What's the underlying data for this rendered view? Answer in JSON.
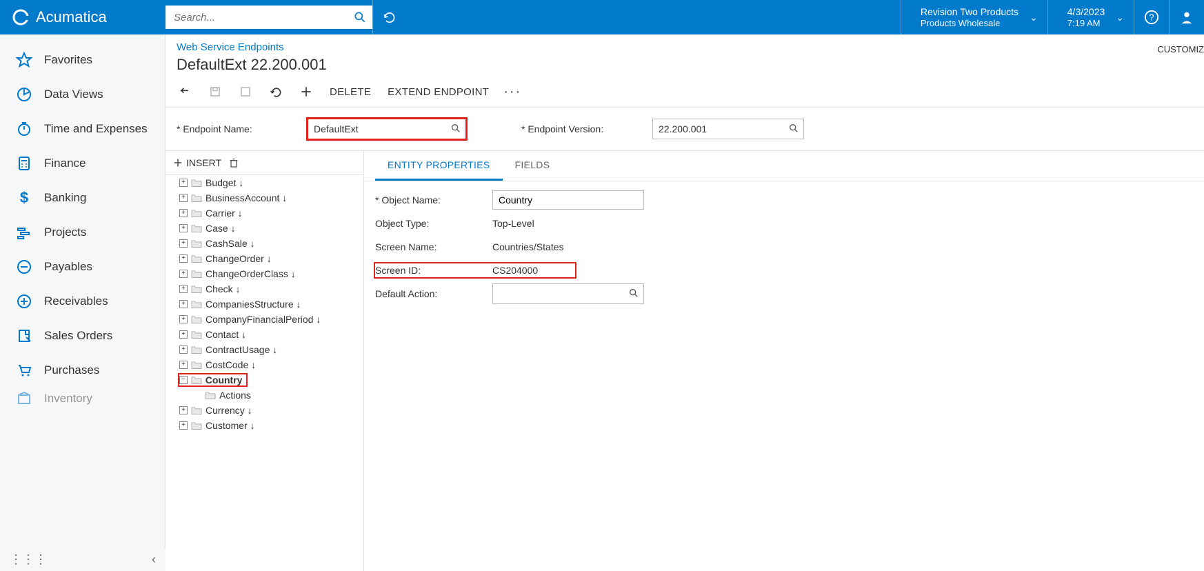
{
  "brand": "Acumatica",
  "search": {
    "placeholder": "Search..."
  },
  "header": {
    "company": "Revision Two Products",
    "company_sub": "Products Wholesale",
    "date": "4/3/2023",
    "time": "7:19 AM"
  },
  "sidebar": {
    "items": [
      {
        "label": "Favorites",
        "icon": "star"
      },
      {
        "label": "Data Views",
        "icon": "pie"
      },
      {
        "label": "Time and Expenses",
        "icon": "stopwatch"
      },
      {
        "label": "Finance",
        "icon": "calculator"
      },
      {
        "label": "Banking",
        "icon": "dollar"
      },
      {
        "label": "Projects",
        "icon": "gantt"
      },
      {
        "label": "Payables",
        "icon": "minus-circle"
      },
      {
        "label": "Receivables",
        "icon": "plus-circle"
      },
      {
        "label": "Sales Orders",
        "icon": "note"
      },
      {
        "label": "Purchases",
        "icon": "cart"
      },
      {
        "label": "Inventory",
        "icon": "box"
      }
    ]
  },
  "breadcrumb": "Web Service Endpoints",
  "page_title": "DefaultExt 22.200.001",
  "customize": "CUSTOMIZ",
  "toolbar": {
    "delete": "DELETE",
    "extend": "EXTEND ENDPOINT"
  },
  "form": {
    "endpoint_name_label": "Endpoint Name:",
    "endpoint_name_value": "DefaultExt",
    "endpoint_version_label": "Endpoint Version:",
    "endpoint_version_value": "22.200.001"
  },
  "tree_toolbar": {
    "insert": "INSERT"
  },
  "tree": {
    "nodes": [
      {
        "label": "Budget ↓"
      },
      {
        "label": "BusinessAccount ↓"
      },
      {
        "label": "Carrier ↓"
      },
      {
        "label": "Case ↓"
      },
      {
        "label": "CashSale ↓"
      },
      {
        "label": "ChangeOrder ↓"
      },
      {
        "label": "ChangeOrderClass ↓"
      },
      {
        "label": "Check ↓"
      },
      {
        "label": "CompaniesStructure ↓"
      },
      {
        "label": "CompanyFinancialPeriod ↓"
      },
      {
        "label": "Contact ↓"
      },
      {
        "label": "ContractUsage ↓"
      },
      {
        "label": "CostCode ↓"
      },
      {
        "label": "Country",
        "selected": true,
        "expanded": true
      },
      {
        "label": "Currency ↓"
      },
      {
        "label": "Customer ↓"
      }
    ],
    "actions_label": "Actions"
  },
  "tabs": {
    "props": "ENTITY PROPERTIES",
    "fields": "FIELDS"
  },
  "props": {
    "object_name_label": "Object Name:",
    "object_name_value": "Country",
    "object_type_label": "Object Type:",
    "object_type_value": "Top-Level",
    "screen_name_label": "Screen Name:",
    "screen_name_value": "Countries/States",
    "screen_id_label": "Screen ID:",
    "screen_id_value": "CS204000",
    "default_action_label": "Default Action:"
  }
}
